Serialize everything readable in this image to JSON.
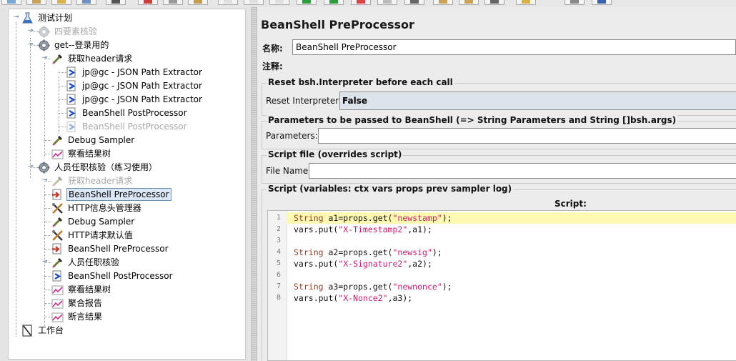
{
  "toolbar": {
    "buttons": [
      "new",
      "templates",
      "open",
      "save",
      "save-as-image",
      "cut",
      "copy",
      "paste",
      "expand",
      "collapse",
      "toggle",
      "start",
      "start-no-pause",
      "stop",
      "shutdown",
      "remote-start",
      "clear",
      "clear-all",
      "search",
      "reset-search",
      "function-helper",
      "help"
    ]
  },
  "tree": {
    "nodes": [
      {
        "id": "n0",
        "label": "测试计划",
        "icon": "testplan-icon",
        "depth": 0,
        "disabled": false,
        "selected": false,
        "toggle": "-"
      },
      {
        "id": "n1",
        "label": "四要素核验",
        "icon": "gear-icon",
        "depth": 1,
        "disabled": true,
        "selected": false,
        "toggle": "+"
      },
      {
        "id": "n2",
        "label": "get--登录用的",
        "icon": "gear-icon",
        "depth": 1,
        "disabled": false,
        "selected": false,
        "toggle": "-"
      },
      {
        "id": "n3",
        "label": "获取header请求",
        "icon": "pipette-icon",
        "depth": 2,
        "disabled": false,
        "selected": false,
        "toggle": "-"
      },
      {
        "id": "n4",
        "label": "jp@gc - JSON Path Extractor",
        "icon": "postprocessor-icon",
        "depth": 3,
        "disabled": false,
        "selected": false,
        "toggle": ""
      },
      {
        "id": "n5",
        "label": "jp@gc - JSON Path Extractor",
        "icon": "postprocessor-icon",
        "depth": 3,
        "disabled": false,
        "selected": false,
        "toggle": ""
      },
      {
        "id": "n6",
        "label": "jp@gc - JSON Path Extractor",
        "icon": "postprocessor-icon",
        "depth": 3,
        "disabled": false,
        "selected": false,
        "toggle": ""
      },
      {
        "id": "n7",
        "label": "BeanShell PostProcessor",
        "icon": "postprocessor-icon",
        "depth": 3,
        "disabled": false,
        "selected": false,
        "toggle": ""
      },
      {
        "id": "n8",
        "label": "BeanShell PostProcessor",
        "icon": "postprocessor-icon",
        "depth": 3,
        "disabled": true,
        "selected": false,
        "toggle": ""
      },
      {
        "id": "n9",
        "label": "Debug Sampler",
        "icon": "pipette-icon",
        "depth": 2,
        "disabled": false,
        "selected": false,
        "toggle": ""
      },
      {
        "id": "n10",
        "label": "察看结果树",
        "icon": "listener-icon",
        "depth": 2,
        "disabled": false,
        "selected": false,
        "toggle": ""
      },
      {
        "id": "n11",
        "label": "人员任职核验（练习使用）",
        "icon": "gear-icon",
        "depth": 1,
        "disabled": false,
        "selected": false,
        "toggle": "-"
      },
      {
        "id": "n12",
        "label": "获取header请求",
        "icon": "pipette-icon",
        "depth": 2,
        "disabled": true,
        "selected": false,
        "toggle": "+"
      },
      {
        "id": "n13",
        "label": "BeanShell PreProcessor",
        "icon": "preprocessor-icon",
        "depth": 2,
        "disabled": false,
        "selected": true,
        "toggle": ""
      },
      {
        "id": "n14",
        "label": "HTTP信息头管理器",
        "icon": "config-icon",
        "depth": 2,
        "disabled": false,
        "selected": false,
        "toggle": ""
      },
      {
        "id": "n15",
        "label": "Debug Sampler",
        "icon": "pipette-icon",
        "depth": 2,
        "disabled": false,
        "selected": false,
        "toggle": ""
      },
      {
        "id": "n16",
        "label": "HTTP请求默认值",
        "icon": "config-icon",
        "depth": 2,
        "disabled": false,
        "selected": false,
        "toggle": ""
      },
      {
        "id": "n17",
        "label": "BeanShell PreProcessor",
        "icon": "preprocessor-icon",
        "depth": 2,
        "disabled": false,
        "selected": false,
        "toggle": ""
      },
      {
        "id": "n18",
        "label": "人员任职核验",
        "icon": "pipette-icon",
        "depth": 2,
        "disabled": false,
        "selected": false,
        "toggle": "-"
      },
      {
        "id": "n19",
        "label": "BeanShell PostProcessor",
        "icon": "postprocessor-icon",
        "depth": 2,
        "disabled": false,
        "selected": false,
        "toggle": ""
      },
      {
        "id": "n20",
        "label": "察看结果树",
        "icon": "listener-icon",
        "depth": 2,
        "disabled": false,
        "selected": false,
        "toggle": ""
      },
      {
        "id": "n21",
        "label": "聚合报告",
        "icon": "listener-icon",
        "depth": 2,
        "disabled": false,
        "selected": false,
        "toggle": ""
      },
      {
        "id": "n22",
        "label": "断言结果",
        "icon": "listener-icon",
        "depth": 2,
        "disabled": false,
        "selected": false,
        "toggle": ""
      },
      {
        "id": "n23",
        "label": "工作台",
        "icon": "workbench-icon",
        "depth": 0,
        "disabled": false,
        "selected": false,
        "toggle": ""
      }
    ]
  },
  "editor": {
    "title": "BeanShell PreProcessor",
    "name_label": "名称:",
    "name_value": "BeanShell PreProcessor",
    "comment_label": "注释:",
    "comment_value": "",
    "reset_group": {
      "legend": "Reset bsh.Interpreter before each call",
      "label": "Reset Interpreter:",
      "value": "False"
    },
    "params_group": {
      "legend": "Parameters to be passed to BeanShell (=> String Parameters and String []bsh.args)",
      "label": "Parameters:",
      "value": ""
    },
    "file_group": {
      "legend": "Script file (overrides script)",
      "label": "File Name:",
      "value": ""
    },
    "script_group": {
      "legend": "Script (variables: ctx vars props prev sampler log)",
      "header": "Script:",
      "lines": [
        [
          {
            "t": "String",
            "c": "kw"
          },
          {
            "t": " a1=props.get(",
            "c": ""
          },
          {
            "t": "\"newstamp\"",
            "c": "str"
          },
          {
            "t": ");",
            "c": ""
          }
        ],
        [
          {
            "t": "vars.put(",
            "c": ""
          },
          {
            "t": "\"X-Timestamp2\"",
            "c": "str"
          },
          {
            "t": ",a1);",
            "c": ""
          }
        ],
        [],
        [
          {
            "t": "String",
            "c": "kw"
          },
          {
            "t": " a2=props.get(",
            "c": ""
          },
          {
            "t": "\"newsig\"",
            "c": "str"
          },
          {
            "t": ");",
            "c": ""
          }
        ],
        [
          {
            "t": "vars.put(",
            "c": ""
          },
          {
            "t": "\"X-Signature2\"",
            "c": "str"
          },
          {
            "t": ",a2);",
            "c": ""
          }
        ],
        [],
        [
          {
            "t": "String",
            "c": "kw"
          },
          {
            "t": " a3=props.get(",
            "c": ""
          },
          {
            "t": "\"newnonce\"",
            "c": "str"
          },
          {
            "t": ");",
            "c": ""
          }
        ],
        [
          {
            "t": "vars.put(",
            "c": ""
          },
          {
            "t": "\"X-Nonce2\"",
            "c": "str"
          },
          {
            "t": ",a3);",
            "c": ""
          }
        ]
      ],
      "line_numbers": [
        "1",
        "2",
        "3",
        "4",
        "5",
        "6",
        "7",
        "8"
      ],
      "highlighted_line": 1
    }
  },
  "colors": {
    "selection_bg": "#dbe7f6",
    "current_line": "#fdf8b2",
    "keyword": "#8b3f26",
    "string": "#c11b6f"
  }
}
